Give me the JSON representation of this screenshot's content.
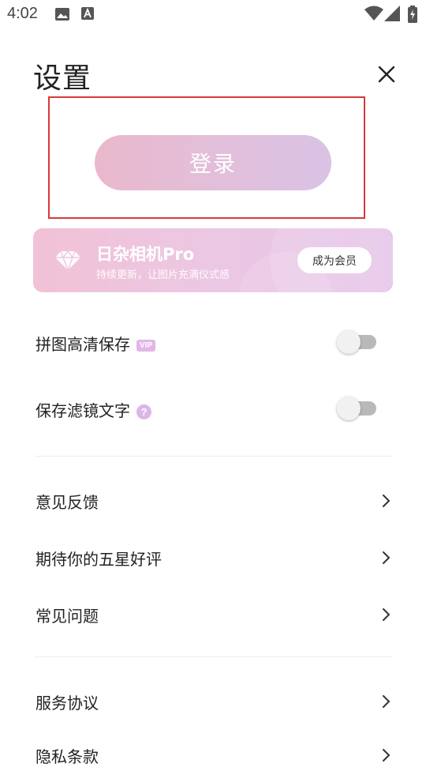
{
  "status_bar": {
    "time": "4:02",
    "icons": [
      "image-icon",
      "a-box-icon",
      "wifi-icon",
      "signal-icon",
      "battery-charging-icon"
    ]
  },
  "header": {
    "title": "设置",
    "close_icon": "close-icon"
  },
  "login": {
    "label": "登录",
    "highlight_color": "#d9393a"
  },
  "vip_banner": {
    "title": "日杂相机Pro",
    "subtitle": "持续更新，让图片充满仪式感",
    "cta": "成为会员",
    "icon": "diamond-icon"
  },
  "toggles": [
    {
      "label": "拼图高清保存",
      "tag": "VIP",
      "on": false
    },
    {
      "label": "保存滤镜文字",
      "help": "?",
      "on": false
    }
  ],
  "menu_group_1": [
    {
      "label": "意见反馈"
    },
    {
      "label": "期待你的五星好评"
    },
    {
      "label": "常见问题"
    }
  ],
  "menu_group_2": [
    {
      "label": "服务协议"
    },
    {
      "label": "隐私条款"
    }
  ]
}
